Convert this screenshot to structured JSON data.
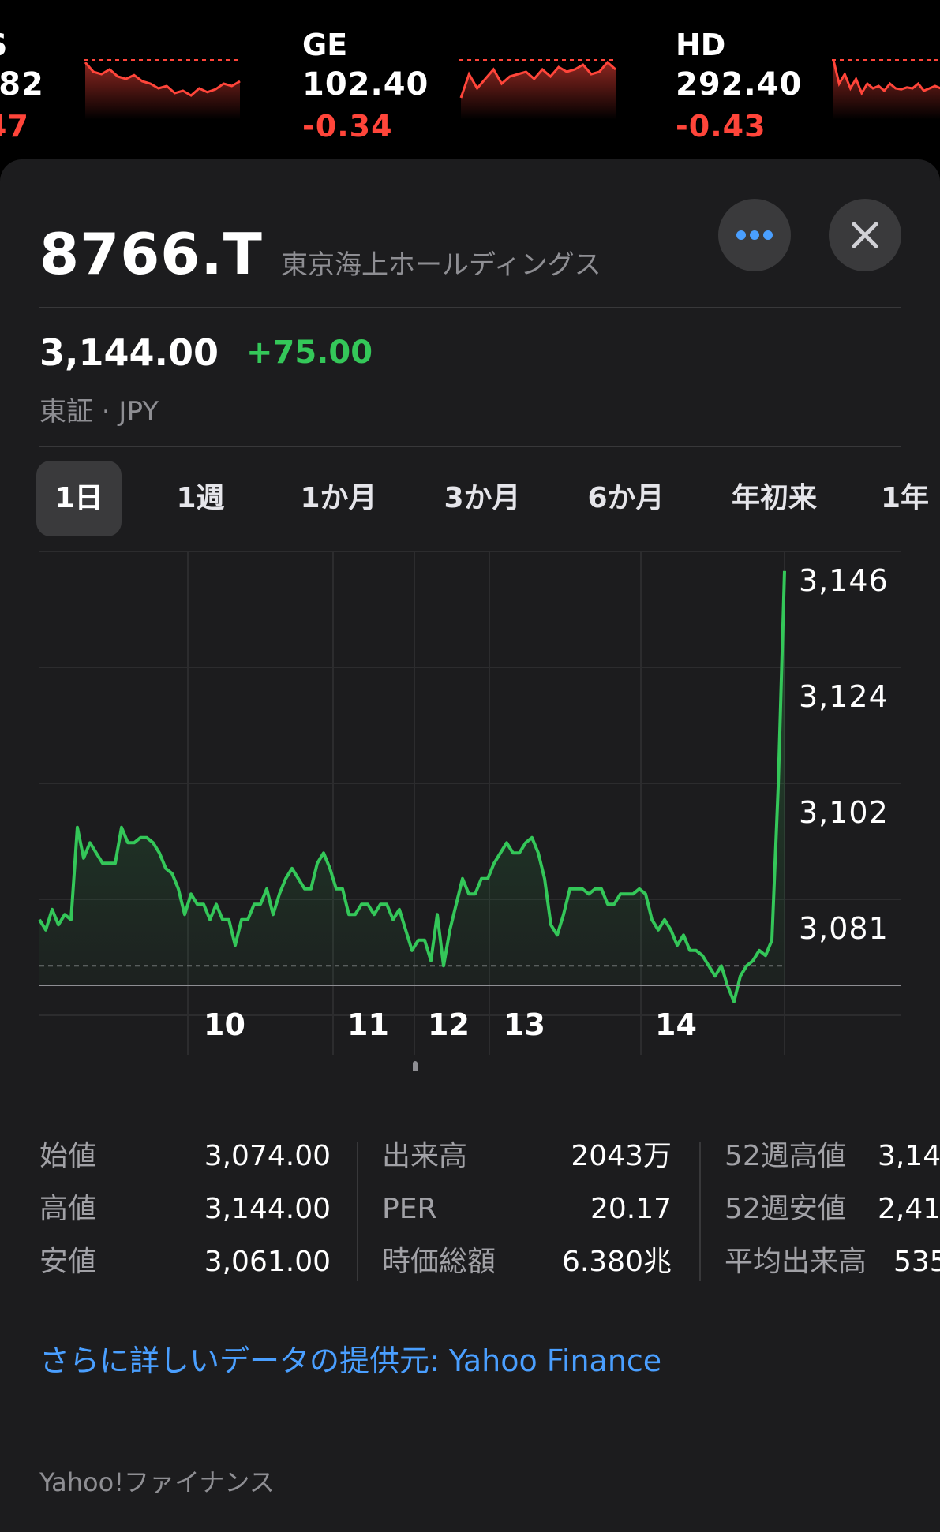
{
  "ticker": [
    {
      "symbol": "S",
      "price": ".82",
      "change": "47",
      "trend": [
        0.15,
        0.35,
        0.4,
        0.3,
        0.45,
        0.5,
        0.42,
        0.55,
        0.6,
        0.7,
        0.65,
        0.8,
        0.75,
        0.85,
        0.7,
        0.78,
        0.72,
        0.6,
        0.65,
        0.55
      ]
    },
    {
      "symbol": "GE",
      "price": "102.40",
      "change": "-0.34",
      "trend": [
        0.9,
        0.4,
        0.7,
        0.5,
        0.3,
        0.6,
        0.45,
        0.4,
        0.35,
        0.5,
        0.3,
        0.45,
        0.25,
        0.35,
        0.3,
        0.2,
        0.4,
        0.35,
        0.15,
        0.3
      ]
    },
    {
      "symbol": "HD",
      "price": "292.40",
      "change": "-0.43",
      "trend": [
        0.1,
        0.6,
        0.4,
        0.7,
        0.5,
        0.8,
        0.6,
        0.7,
        0.65,
        0.75,
        0.6,
        0.7,
        0.72,
        0.68,
        0.7,
        0.6,
        0.75,
        0.7,
        0.65,
        0.7
      ]
    }
  ],
  "header": {
    "symbol": "8766.T",
    "company": "東京海上ホールディングス",
    "more_icon": "ellipsis-icon",
    "close_icon": "close-icon"
  },
  "quote": {
    "price": "3,144.00",
    "change": "+75.00",
    "exchange": "東証 · JPY"
  },
  "tabs": [
    "1日",
    "1週",
    "1か月",
    "3か月",
    "6か月",
    "年初来",
    "1年"
  ],
  "active_tab": 0,
  "colors": {
    "positive": "#34c759",
    "negative": "#ff453a",
    "link": "#4a9fff"
  },
  "chart_data": {
    "type": "line",
    "y_ticks": [
      "3,146",
      "3,124",
      "3,102",
      "3,081"
    ],
    "y_tick_values": [
      3146,
      3124,
      3102,
      3081
    ],
    "x_tick_labels": [
      "10",
      "11",
      "12",
      "13",
      "14"
    ],
    "previous_close": 3069,
    "ylim": [
      3065.2,
      3149.5
    ],
    "values": [
      3078,
      3076,
      3080,
      3077,
      3079,
      3078,
      3096,
      3090,
      3093,
      3091,
      3089,
      3089,
      3089,
      3096,
      3093,
      3093,
      3094,
      3094,
      3093,
      3091,
      3088,
      3087,
      3084,
      3079,
      3083,
      3081,
      3081,
      3078,
      3081,
      3078,
      3078,
      3073,
      3078,
      3078,
      3081,
      3081,
      3084,
      3079,
      3083,
      3086,
      3088,
      3086,
      3084,
      3084,
      3089,
      3091,
      3088,
      3084,
      3084,
      3079,
      3079,
      3081,
      3081,
      3079,
      3081,
      3081,
      3078,
      3080,
      3076,
      3072,
      3074,
      3074,
      3070,
      3079,
      3069,
      3076,
      3081,
      3086,
      3083,
      3083,
      3086,
      3086,
      3089,
      3091,
      3093,
      3091,
      3091,
      3093,
      3094,
      3091,
      3086,
      3077,
      3075,
      3079,
      3084,
      3084,
      3084,
      3083,
      3084,
      3084,
      3081,
      3081,
      3083,
      3083,
      3083,
      3084,
      3083,
      3078,
      3076,
      3078,
      3076,
      3073,
      3075,
      3072,
      3072,
      3071,
      3069,
      3067,
      3069,
      3065,
      3062,
      3067,
      3069,
      3070,
      3072,
      3071,
      3074,
      3104,
      3146
    ]
  },
  "stats": [
    [
      {
        "label": "始値",
        "value": "3,074.00"
      },
      {
        "label": "高値",
        "value": "3,144.00"
      },
      {
        "label": "安値",
        "value": "3,061.00"
      }
    ],
    [
      {
        "label": "出来高",
        "value": "2043万"
      },
      {
        "label": "PER",
        "value": "20.17"
      },
      {
        "label": "時価総額",
        "value": "6.380兆"
      }
    ],
    [
      {
        "label": "52週高値",
        "value": "3,14"
      },
      {
        "label": "52週安値",
        "value": "2,41"
      },
      {
        "label": "平均出来高",
        "value": "535"
      }
    ]
  ],
  "footer": {
    "more_data": "さらに詳しいデータの提供元: Yahoo Finance",
    "source": "Yahoo!ファイナンス"
  }
}
